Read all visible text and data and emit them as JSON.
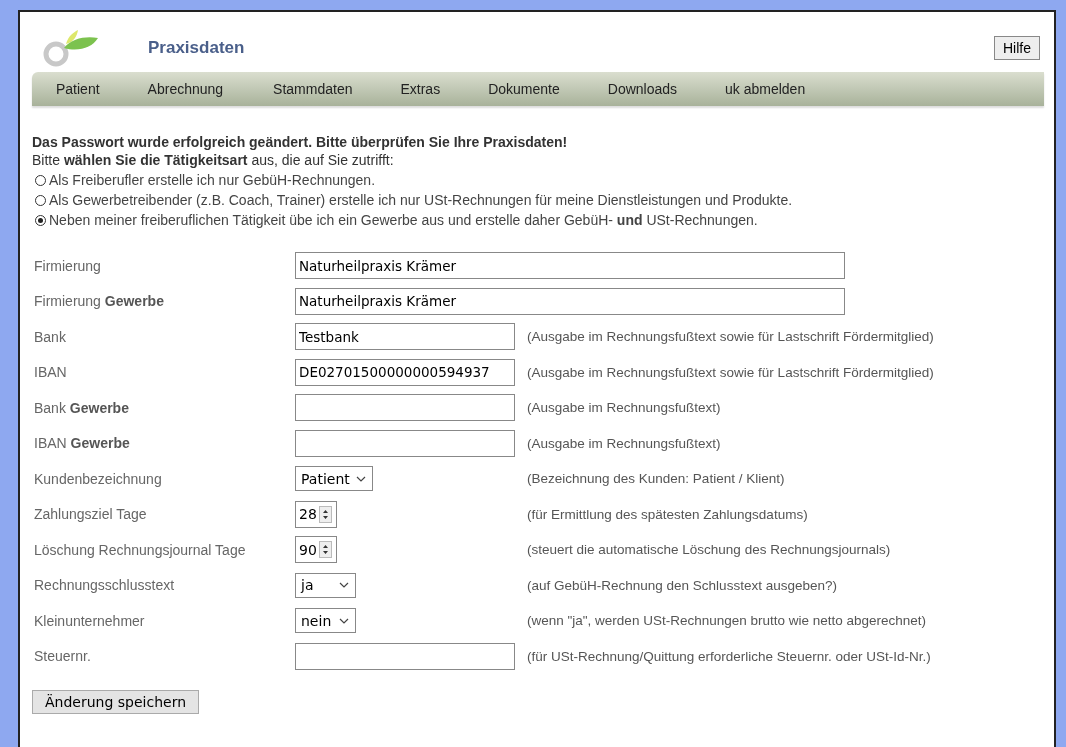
{
  "header": {
    "title": "Praxisdaten",
    "help_button": "Hilfe"
  },
  "nav": [
    {
      "label": "Patient"
    },
    {
      "label": "Abrechnung"
    },
    {
      "label": "Stammdaten"
    },
    {
      "label": "Extras"
    },
    {
      "label": "Dokumente"
    },
    {
      "label": "Downloads"
    },
    {
      "label": "uk abmelden"
    }
  ],
  "message": "Das Passwort wurde erfolgreich geändert. Bitte überprüfen Sie Ihre Praxisdaten!",
  "instruction": "Bitte **wählen Sie die Tätigkeitsart** aus, die auf Sie zutrifft:",
  "options": [
    {
      "label": "Als Freiberufler erstelle ich nur GebüH-Rechnungen.",
      "selected": false
    },
    {
      "label": "Als Gewerbetreibender (z.B. Coach, Trainer) erstelle ich nur USt-Rechnungen für meine Dienstleistungen und Produkte.",
      "selected": false
    },
    {
      "label": "Neben meiner freiberuflichen Tätigkeit übe ich ein Gewerbe aus und erstelle daher GebüH- **und** USt-Rechnungen.",
      "selected": true
    }
  ],
  "fields": [
    {
      "label": "Firmierung",
      "kind": "wide",
      "value": "Naturheilpraxis Krämer"
    },
    {
      "label": "Firmierung **Gewerbe**",
      "kind": "wide",
      "value": "Naturheilpraxis Krämer"
    },
    {
      "label": "Bank",
      "kind": "text",
      "value": "Testbank",
      "hint": "(Ausgabe im Rechnungsfußtext sowie für Lastschrift Fördermitglied)"
    },
    {
      "label": "IBAN",
      "kind": "text",
      "value": "DE02701500000000594937",
      "hint": "(Ausgabe im Rechnungsfußtext sowie für Lastschrift Fördermitglied)"
    },
    {
      "label": "Bank **Gewerbe**",
      "kind": "text",
      "hint": "(Ausgabe im Rechnungsfußtext)"
    },
    {
      "label": "IBAN **Gewerbe**",
      "kind": "text",
      "hint": "(Ausgabe im Rechnungsfußtext)"
    },
    {
      "label": "Kundenbezeichnung",
      "kind": "select",
      "value": "Patient",
      "hint": "(Bezeichnung des Kunden: Patient / Klient)"
    },
    {
      "label": "Zahlungsziel Tage",
      "kind": "number",
      "value": "28",
      "hint": "(für Ermittlung des spätesten Zahlungsdatums)"
    },
    {
      "label": "Löschung Rechnungsjournal Tage",
      "kind": "number",
      "value": "90",
      "hint": "(steuert die automatische Löschung des Rechnungsjournals)"
    },
    {
      "label": "Rechnungsschlusstext",
      "kind": "select",
      "value": "ja",
      "hint": "(auf GebüH-Rechnung den Schlusstext ausgeben?)"
    },
    {
      "label": "Kleinunternehmer",
      "kind": "select",
      "value": "nein",
      "hint": "(wenn \"ja\", werden USt-Rechnungen brutto wie netto abgerechnet)"
    },
    {
      "label": "Steuernr.",
      "kind": "text",
      "hint": "(für USt-Rechnung/Quittung erforderliche Steuernr. oder USt-Id-Nr.)"
    }
  ],
  "save_button": "Änderung speichern"
}
